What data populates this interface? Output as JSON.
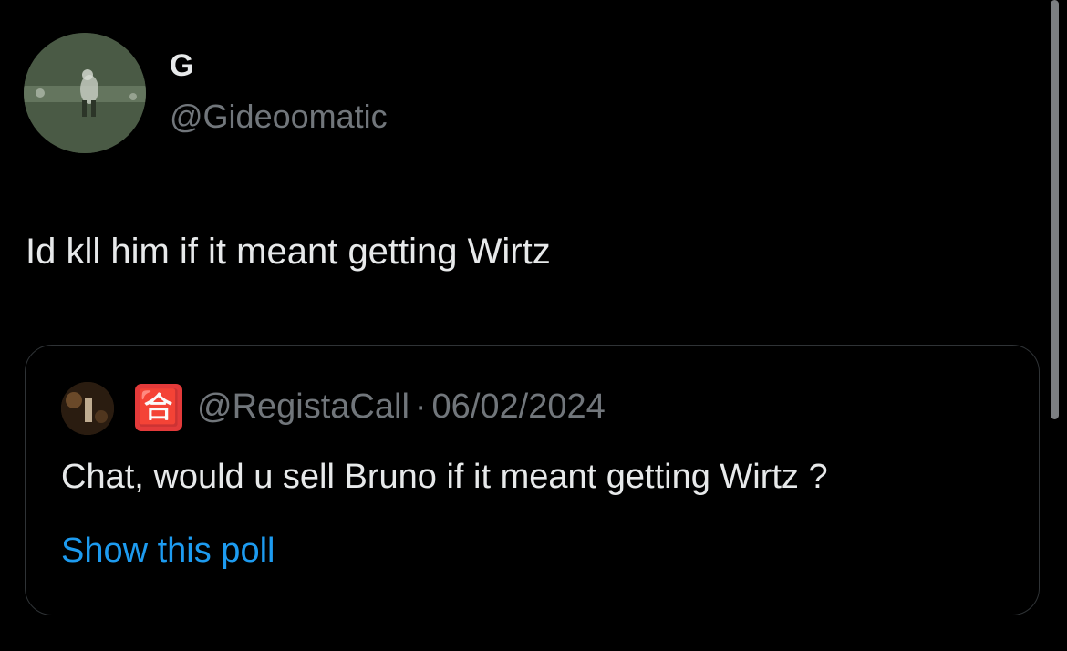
{
  "tweet": {
    "display_name": "G",
    "handle": "@Gideoomatic",
    "text": "Id kll him if it meant getting Wirtz",
    "avatar_icon": "profile-photo-icon"
  },
  "quote": {
    "emoji": "🈴",
    "handle": "@RegistaCall",
    "separator": "·",
    "date": "06/02/2024",
    "text": "Chat, would u sell Bruno if it meant getting Wirtz ?",
    "link_label": "Show this poll",
    "link_color": "#1d9bf0"
  },
  "colors": {
    "background": "#000000",
    "primary_text": "#e7e9ea",
    "secondary_text": "#71767b",
    "border": "#2f3336"
  }
}
